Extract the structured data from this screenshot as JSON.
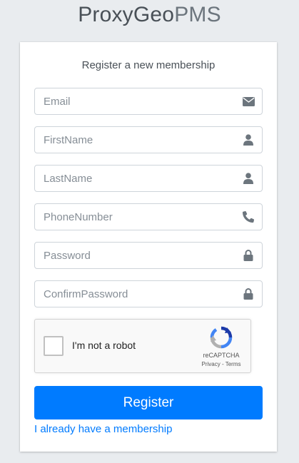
{
  "logo": {
    "bold": "ProxyGeo",
    "light": "PMS"
  },
  "card": {
    "message": "Register a new membership"
  },
  "fields": {
    "email": {
      "placeholder": "Email",
      "icon": "envelope-icon"
    },
    "first_name": {
      "placeholder": "FirstName",
      "icon": "user-icon"
    },
    "last_name": {
      "placeholder": "LastName",
      "icon": "user-icon"
    },
    "phone": {
      "placeholder": "PhoneNumber",
      "icon": "phone-icon"
    },
    "password": {
      "placeholder": "Password",
      "icon": "lock-icon"
    },
    "confirm_password": {
      "placeholder": "ConfirmPassword",
      "icon": "lock-icon"
    }
  },
  "captcha": {
    "label": "I'm not a robot",
    "brand": "reCAPTCHA",
    "privacy": "Privacy",
    "separator": " - ",
    "terms": "Terms"
  },
  "register_button": "Register",
  "login_link": "I already have a membership",
  "colors": {
    "primary": "#007bff",
    "background": "#e9ecef",
    "icon": "#6c757d"
  }
}
